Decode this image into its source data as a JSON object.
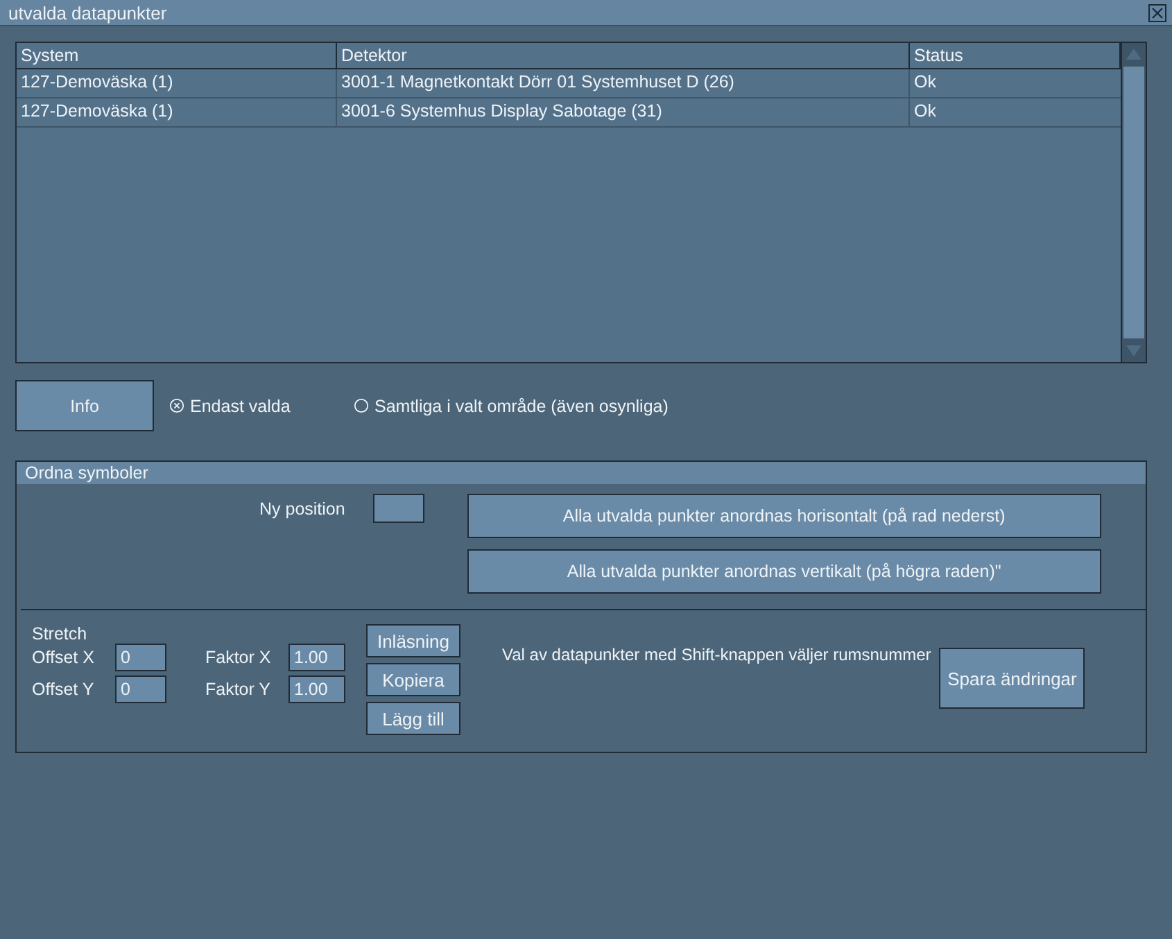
{
  "window": {
    "title": "utvalda datapunkter"
  },
  "table": {
    "columns": [
      "System",
      "Detektor",
      "Status"
    ],
    "rows": [
      {
        "cells": [
          "127-Demoväska (1)",
          "3001-1 Magnetkontakt Dörr 01 Systemhuset D (26)",
          "Ok"
        ]
      },
      {
        "cells": [
          "127-Demoväska (1)",
          "3001-6 Systemhus Display Sabotage (31)",
          "Ok"
        ]
      }
    ]
  },
  "info_button": "Info",
  "scope_options": [
    {
      "label": "Endast valda",
      "selected": true
    },
    {
      "label": "Samtliga i valt område (även osynliga)",
      "selected": false
    }
  ],
  "arrange": {
    "title": "Ordna symboler",
    "position_label": "Ny position",
    "buttons": [
      "Alla utvalda punkter anordnas horisontalt (på rad nederst)",
      "Alla utvalda punkter anordnas vertikalt (på högra raden)\""
    ]
  },
  "stretch": {
    "title": "Stretch",
    "fields": [
      {
        "label": "Offset X",
        "value": "0"
      },
      {
        "label": "Faktor X",
        "value": "1.00"
      },
      {
        "label": "Offset Y",
        "value": "0"
      },
      {
        "label": "Faktor Y",
        "value": "1.00"
      }
    ],
    "buttons": [
      "Inläsning",
      "Kopiera",
      "Lägg till"
    ],
    "hint": "Val av datapunkter med Shift-knappen väljer rumsnummer",
    "save_button": "Spara ändringar"
  }
}
